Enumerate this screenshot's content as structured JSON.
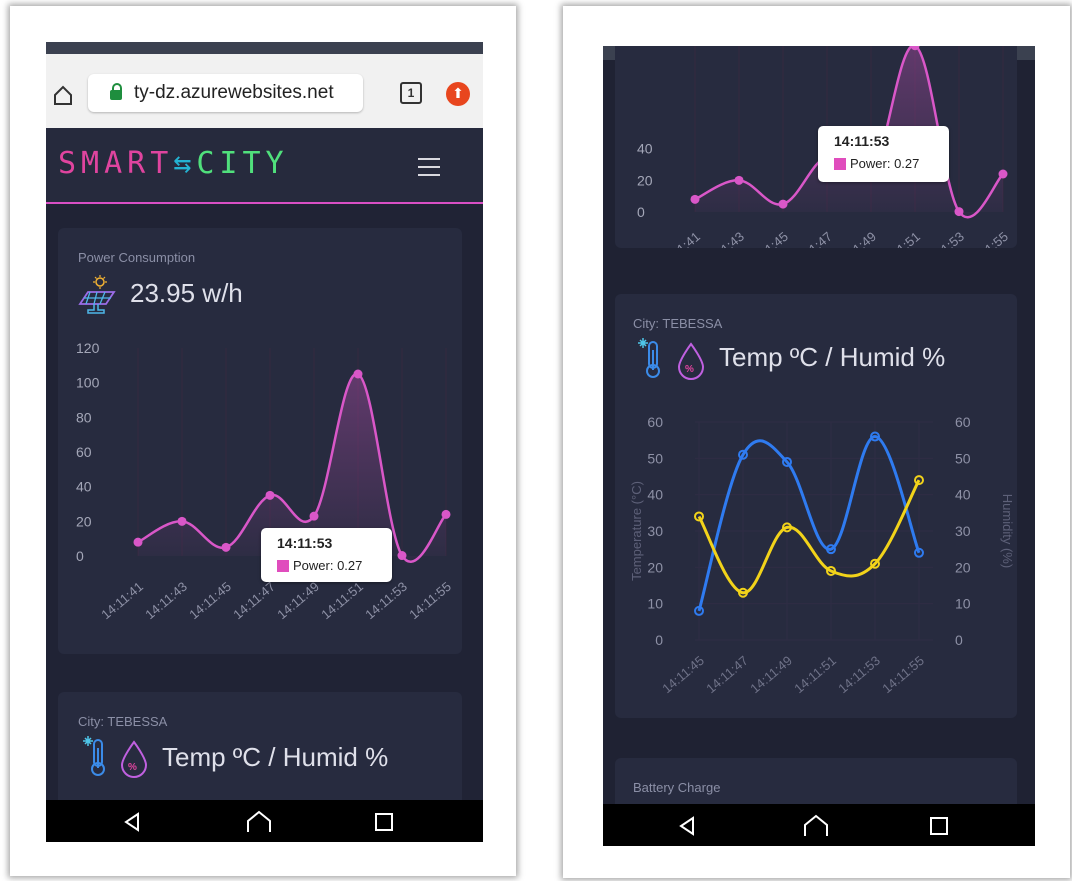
{
  "left": {
    "url": "ty-dz.azurewebsites.net",
    "tabs_count": "1",
    "logo": {
      "part1": "SMART",
      "part2": "⇆",
      "part3": "CITY"
    },
    "power_card": {
      "subtitle": "Power Consumption",
      "value": "23.95 w/h",
      "tooltip_time": "14:11:53",
      "tooltip_value": "Power: 0.27"
    },
    "temp_card": {
      "subtitle": "City: TEBESSA",
      "title": "Temp ºC / Humid %"
    }
  },
  "right": {
    "temp_card": {
      "subtitle": "City: TEBESSA",
      "title": "Temp ºC / Humid %"
    },
    "power_tooltip_time": "14:11:53",
    "power_tooltip_value": "Power: 0.27",
    "battery_card": {
      "subtitle": "Battery Charge"
    }
  },
  "colors": {
    "power": "#d957c8",
    "temperature": "#2f7bf0",
    "humidity": "#f2d31a"
  },
  "chart_data": [
    {
      "type": "area",
      "title": "Power Consumption",
      "categories": [
        "14:11:41",
        "14:11:43",
        "14:11:45",
        "14:11:47",
        "14:11:49",
        "14:11:51",
        "14:11:53",
        "14:11:55"
      ],
      "series": [
        {
          "name": "Power",
          "values": [
            8,
            20,
            5,
            35,
            23,
            105,
            0.27,
            24
          ]
        }
      ],
      "ylim": [
        0,
        120
      ],
      "yticks": [
        0,
        20,
        40,
        60,
        80,
        100,
        120
      ]
    },
    {
      "type": "line",
      "title": "Temp ºC / Humid %",
      "categories": [
        "14:11:45",
        "14:11:47",
        "14:11:49",
        "14:11:51",
        "14:11:53",
        "14:11:55"
      ],
      "ylabel": "Temperature (°C)",
      "y2label": "Humidity (%)",
      "ylim": [
        0,
        60
      ],
      "y2lim": [
        0,
        60
      ],
      "yticks": [
        0,
        10,
        20,
        30,
        40,
        50,
        60
      ],
      "series": [
        {
          "name": "Temperature",
          "axis": "left",
          "values": [
            8,
            51,
            49,
            25,
            56,
            24
          ]
        },
        {
          "name": "Humidity",
          "axis": "right",
          "values": [
            34,
            13,
            31,
            19,
            21,
            44
          ]
        }
      ]
    }
  ]
}
